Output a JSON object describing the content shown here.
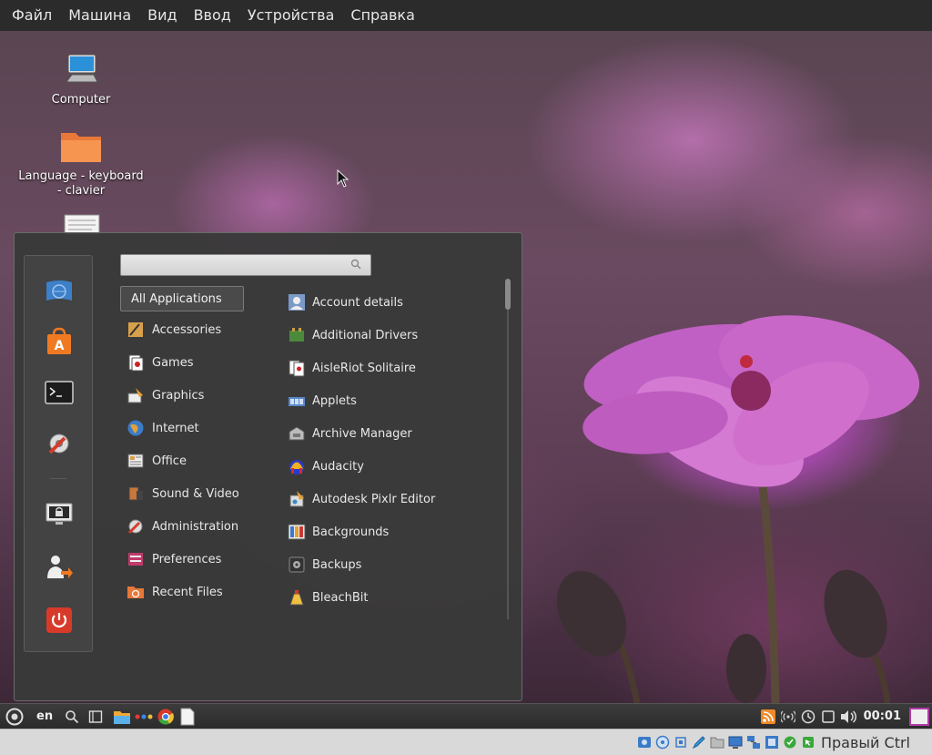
{
  "host_menu": [
    "Файл",
    "Машина",
    "Вид",
    "Ввод",
    "Устройства",
    "Справка"
  ],
  "desktop": {
    "icons": [
      {
        "label": "Computer",
        "icon": "computer-icon"
      },
      {
        "label": "Language - keyboard - clavier",
        "icon": "folder-icon"
      },
      {
        "label": "",
        "icon": "document-icon"
      }
    ]
  },
  "menu": {
    "search_placeholder": "",
    "favorites": [
      "web-browser-icon",
      "software-manager-icon",
      "terminal-icon",
      "system-settings-icon",
      "lock-screen-icon",
      "logout-icon",
      "power-icon"
    ],
    "categories": {
      "all": "All Applications",
      "items": [
        "Accessories",
        "Games",
        "Graphics",
        "Internet",
        "Office",
        "Sound & Video",
        "Administration",
        "Preferences",
        "Recent Files"
      ]
    },
    "apps": [
      "Account details",
      "Additional Drivers",
      "AisleRiot Solitaire",
      "Applets",
      "Archive Manager",
      "Audacity",
      "Autodesk Pixlr Editor",
      "Backgrounds",
      "Backups",
      "BleachBit"
    ]
  },
  "panel": {
    "language": "en",
    "clock": "00:01"
  },
  "host_status": {
    "host_key": "Правый Ctrl"
  }
}
